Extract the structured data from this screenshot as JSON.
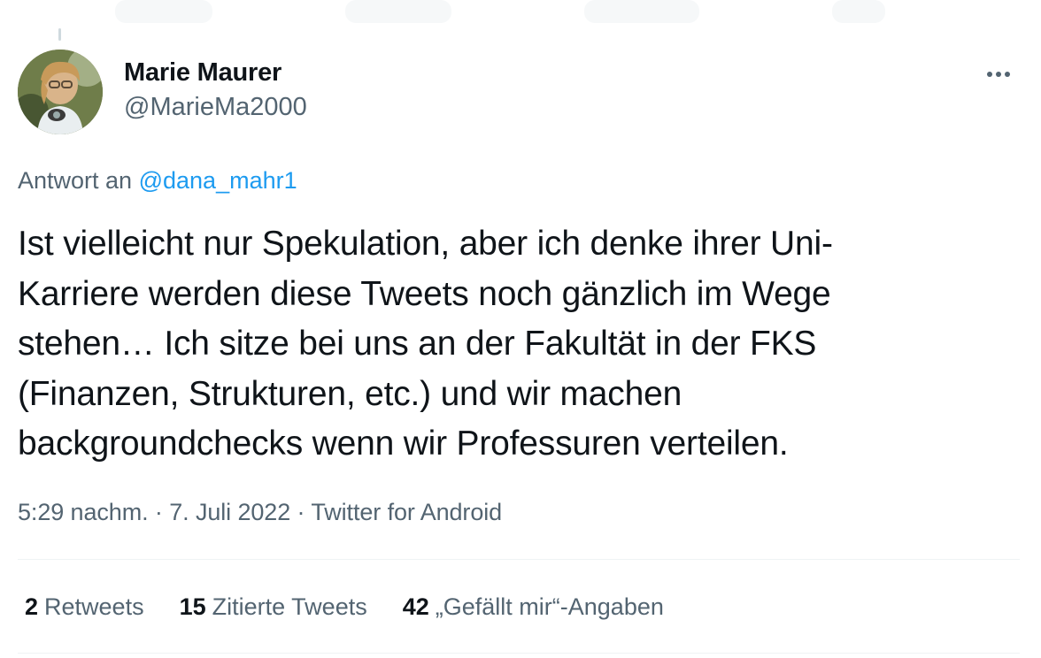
{
  "author": {
    "display_name": "Marie Maurer",
    "handle": "@MarieMa2000"
  },
  "reply": {
    "prefix": "Antwort an",
    "mention": "@dana_mahr1"
  },
  "tweet": {
    "lines": [
      "Ist vielleicht nur Spekulation, aber ich denke ihrer Uni-",
      "Karriere werden diese Tweets noch gänzlich im Wege",
      "stehen… Ich sitze bei uns an der Fakultät in der FKS",
      "(Finanzen, Strukturen, etc.) und wir machen",
      "backgroundchecks wenn wir Professuren verteilen."
    ]
  },
  "meta": {
    "time": "5:29 nachm.",
    "sep1": "·",
    "date": "7. Juli 2022",
    "sep2": "·",
    "source": "Twitter for Android"
  },
  "stats": {
    "retweets_count": "2",
    "retweets_label": "Retweets",
    "quotes_count": "15",
    "quotes_label": "Zitierte Tweets",
    "likes_count": "42",
    "likes_label": "„Gefällt mir“-Angaben"
  },
  "icons": {
    "more": "more-horizontal-icon"
  },
  "colors": {
    "text_primary": "#0f1419",
    "text_secondary": "#536471",
    "link": "#1d9bf0",
    "divider": "#eff3f4"
  }
}
